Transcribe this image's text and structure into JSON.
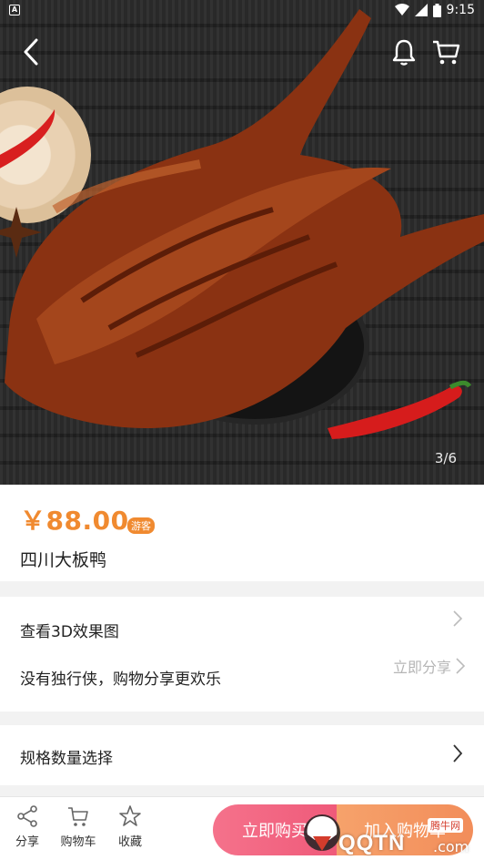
{
  "status_bar": {
    "time": "9:15",
    "notif_glyph": "A"
  },
  "gallery": {
    "pager": "3/6"
  },
  "product": {
    "price": "￥88.00",
    "price_badge": "游客",
    "name": "四川大板鸭"
  },
  "share_card": {
    "view_3d": "查看3D效果图",
    "share_slogan": "没有独行侠，购物分享更欢乐",
    "share_now": "立即分享"
  },
  "spec_card": {
    "label": "规格数量选择"
  },
  "bottom_bar": {
    "share": "分享",
    "cart": "购物车",
    "favorite": "收藏",
    "buy_now": "立即购买",
    "add_to_cart": "加入购物车"
  },
  "watermark": {
    "brand": "QQTN",
    "domain": ".com",
    "tag": "腾牛网"
  },
  "colors": {
    "price": "#f08a30",
    "buy_now": "#ef5a7a",
    "add_to_cart": "#f28d5a"
  }
}
